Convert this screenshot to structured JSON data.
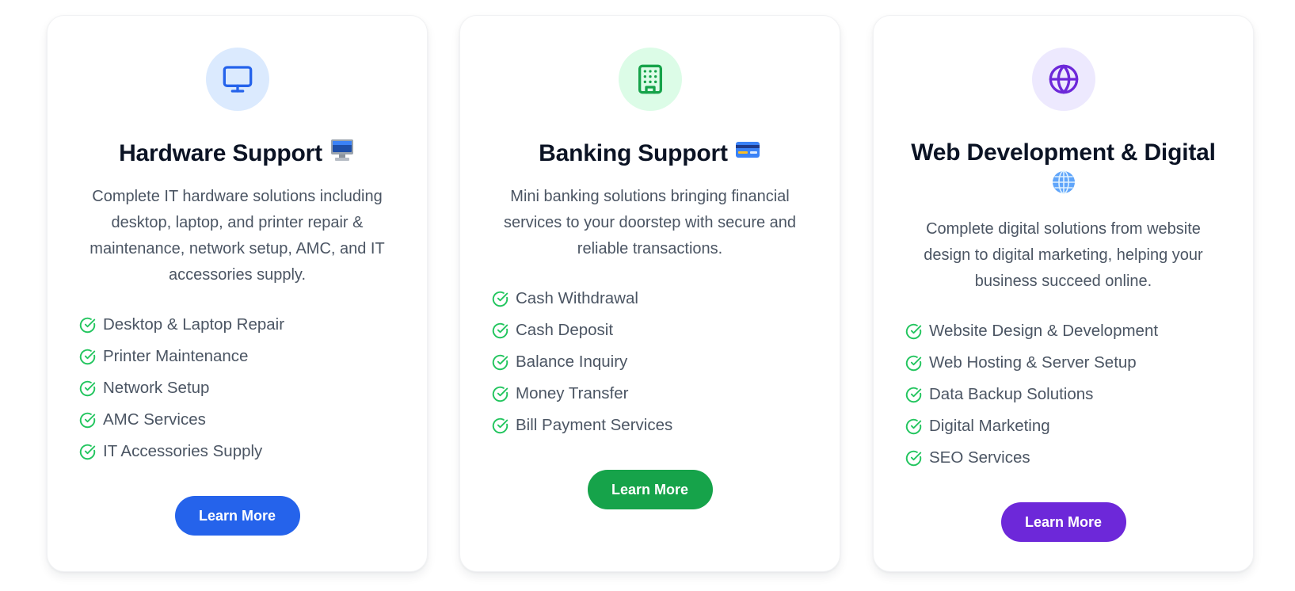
{
  "cards": [
    {
      "title": "Hardware Support",
      "emoji_icon": "desktop-computer-emoji",
      "icon": "monitor-icon",
      "accent_color": "#2563eb",
      "icon_bg_color": "#dbeafe",
      "description": "Complete IT hardware solutions including desktop, laptop, and printer repair & maintenance, network setup, AMC, and IT accessories supply.",
      "features": [
        "Desktop & Laptop Repair",
        "Printer Maintenance",
        "Network Setup",
        "AMC Services",
        "IT Accessories Supply"
      ],
      "button_label": "Learn More"
    },
    {
      "title": "Banking Support",
      "emoji_icon": "credit-card-emoji",
      "icon": "building-icon",
      "accent_color": "#16a34a",
      "icon_bg_color": "#dcfce7",
      "description": "Mini banking solutions bringing financial services to your doorstep with secure and reliable transactions.",
      "features": [
        "Cash Withdrawal",
        "Cash Deposit",
        "Balance Inquiry",
        "Money Transfer",
        "Bill Payment Services"
      ],
      "button_label": "Learn More"
    },
    {
      "title": "Web Development & Digital",
      "emoji_icon": "globe-emoji",
      "icon": "globe-icon",
      "accent_color": "#6d28d9",
      "icon_bg_color": "#ede9fe",
      "description": "Complete digital solutions from website design to digital marketing, helping your business succeed online.",
      "features": [
        "Website Design & Development",
        "Web Hosting & Server Setup",
        "Data Backup Solutions",
        "Digital Marketing",
        "SEO Services"
      ],
      "button_label": "Learn More"
    }
  ],
  "check_color": "#22c55e"
}
